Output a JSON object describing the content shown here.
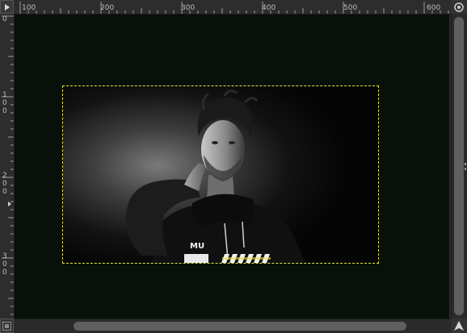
{
  "rulers": {
    "horizontal_labels": [
      "100",
      "200",
      "300",
      "400",
      "500",
      "600"
    ],
    "vertical_labels": [
      "0",
      "100",
      "200",
      "300"
    ]
  },
  "canvas": {
    "background": "#071109",
    "layer_boundary_color": "#e7e24a",
    "image": {
      "content": "black-and-white portrait photo of a man with hand behind neck",
      "shirt_text": "MU"
    }
  },
  "icons": {
    "top_left": "menu-arrow-icon",
    "top_right": "zoom-toggle-icon",
    "bottom_left": "quick-mask-icon",
    "bottom_right": "navigate-icon"
  }
}
